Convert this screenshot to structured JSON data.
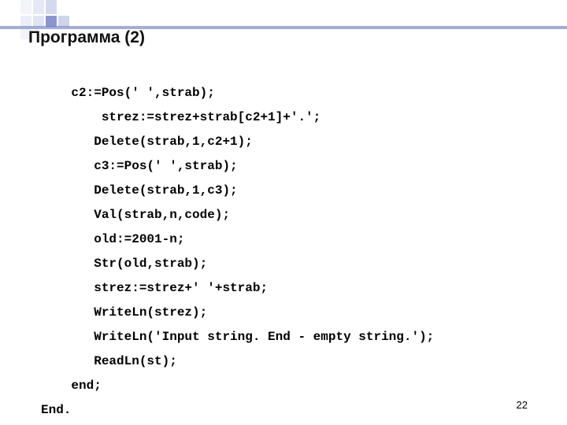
{
  "title": "Программа (2)",
  "page_number": "22",
  "code": {
    "l1": "    c2:=Pos(' ',strab);",
    "l2": "        strez:=strez+strab[c2+1]+'.';",
    "l3": "       Delete(strab,1,c2+1);",
    "l4": "       c3:=Pos(' ',strab);",
    "l5": "       Delete(strab,1,c3);",
    "l6": "       Val(strab,n,code);",
    "l7": "       old:=2001-n;",
    "l8": "       Str(old,strab);",
    "l9": "       strez:=strez+' '+strab;",
    "l10": "       WriteLn(strez);",
    "l11": "       WriteLn('Input string. End - empty string.');",
    "l12": "       ReadLn(st);",
    "l13": "    end;",
    "l14": "End."
  }
}
